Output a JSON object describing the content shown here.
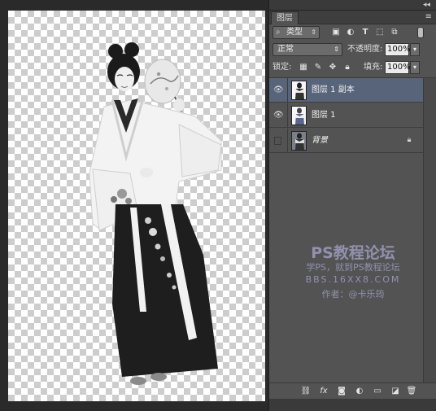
{
  "panel": {
    "collapse_label": "◂◂",
    "tab_label": "图层",
    "menu_icon": "≡"
  },
  "filter": {
    "kind_label": "类型",
    "icons": [
      "image-filter-icon",
      "adjustment-filter-icon",
      "type-filter-icon",
      "shape-filter-icon",
      "smart-object-filter-icon"
    ]
  },
  "blend": {
    "mode": "正常",
    "opacity_label": "不透明度:",
    "opacity_value": "100%",
    "lock_label": "锁定:",
    "fill_label": "填充:",
    "fill_value": "100%"
  },
  "layers": [
    {
      "name": "图层 1 副本",
      "selected": true,
      "visible": true,
      "locked": false
    },
    {
      "name": "图层 1",
      "selected": false,
      "visible": true,
      "locked": false
    },
    {
      "name": "背景",
      "selected": false,
      "visible": false,
      "locked": true
    }
  ],
  "watermark": {
    "line1": "PS教程论坛",
    "line2": "学PS，就到PS教程论坛",
    "line3": "BBS.16XX8.COM",
    "line4": "作者：@卡乐筠"
  },
  "footer_tools": [
    "link-layers-icon",
    "fx-icon",
    "add-mask-icon",
    "new-adjustment-icon",
    "new-group-icon",
    "new-layer-icon",
    "trash-icon"
  ],
  "colors": {
    "panel_bg": "#535353",
    "selected_layer": "#58647a",
    "watermark": "#9c9cbf"
  }
}
